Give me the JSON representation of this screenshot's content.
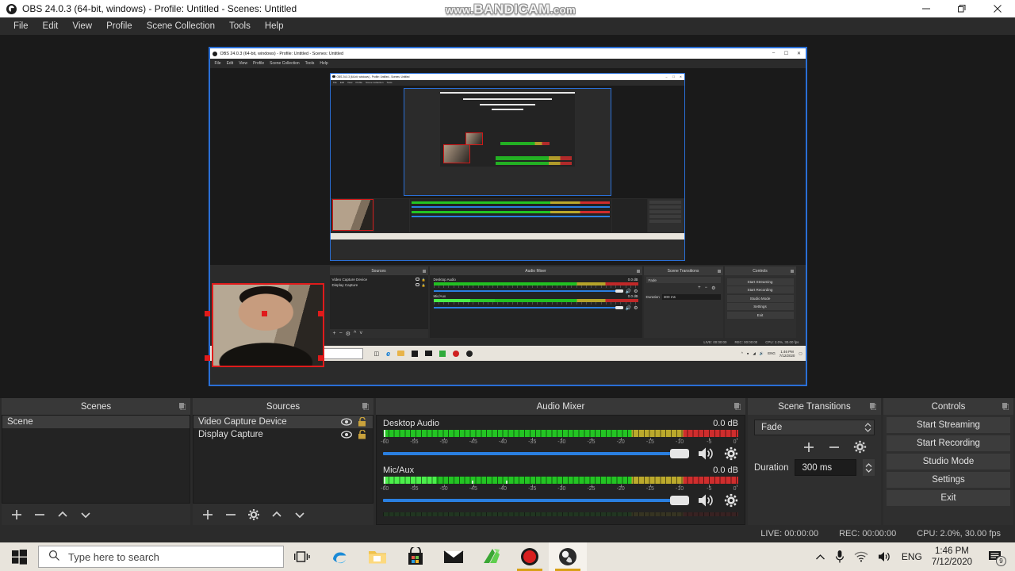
{
  "window": {
    "title": "OBS 24.0.3 (64-bit, windows) - Profile: Untitled - Scenes: Untitled",
    "logo_icon": "obs-logo-icon",
    "minimize_icon": "minimize-icon",
    "restore_icon": "restore-icon",
    "close_icon": "close-icon"
  },
  "watermark": {
    "prefix": "www.",
    "brand": "BANDICAM",
    "suffix": ".com"
  },
  "menubar": {
    "items": [
      "File",
      "Edit",
      "View",
      "Profile",
      "Scene Collection",
      "Tools",
      "Help"
    ]
  },
  "preview": {
    "selected_source_border_color": "#e01b1b",
    "capture_border_color": "#2a6fd6",
    "nested_title": "OBS 24.0.3 (64-bit, windows) - Profile: Untitled - Scenes: Untitled",
    "nested_title_2": "OBS 24.0.3 (64-bit, windows) - Profile: Untitled - Scenes: Untitled"
  },
  "scenes": {
    "header": "Scenes",
    "pin_icon": "pin-icon",
    "items": [
      {
        "label": "Scene",
        "selected": true
      }
    ],
    "footer_icons": [
      "add-icon",
      "remove-icon",
      "move-up-icon",
      "move-down-icon"
    ]
  },
  "sources": {
    "header": "Sources",
    "pin_icon": "pin-icon",
    "items": [
      {
        "label": "Video Capture Device",
        "visible": true,
        "locked": false
      },
      {
        "label": "Display Capture",
        "visible": true,
        "locked": false
      }
    ],
    "footer_icons": [
      "add-icon",
      "remove-icon",
      "properties-gear-icon",
      "move-up-icon",
      "move-down-icon"
    ]
  },
  "audio_mixer": {
    "header": "Audio Mixer",
    "pin_icon": "pin-icon",
    "scale_ticks": [
      -60,
      -55,
      -50,
      -45,
      -40,
      -35,
      -30,
      -25,
      -20,
      -15,
      -10,
      -5,
      0
    ],
    "channels": [
      {
        "name": "Desktop Audio",
        "db": "0.0 dB",
        "level_pct": 100,
        "hot_pct": 0,
        "fader_pct": 100,
        "mute_icon": "speaker-icon",
        "settings_icon": "gear-icon"
      },
      {
        "name": "Mic/Aux",
        "db": "0.0 dB",
        "level_pct": 100,
        "hot_pct": 15,
        "fader_pct": 100,
        "mute_icon": "speaker-icon",
        "settings_icon": "gear-icon"
      }
    ]
  },
  "scene_transitions": {
    "header": "Scene Transitions",
    "pin_icon": "pin-icon",
    "transition": "Fade",
    "duration_label": "Duration",
    "duration_value": "300 ms",
    "icons": [
      "add-icon",
      "remove-icon",
      "gear-icon"
    ]
  },
  "controls": {
    "header": "Controls",
    "pin_icon": "pin-icon",
    "buttons": [
      "Start Streaming",
      "Start Recording",
      "Studio Mode",
      "Settings",
      "Exit"
    ]
  },
  "statusbar": {
    "live": "LIVE: 00:00:00",
    "rec": "REC: 00:00:00",
    "cpu": "CPU: 2.0%, 30.00 fps"
  },
  "taskbar": {
    "start_icon": "windows-start-icon",
    "search_icon": "search-icon",
    "search_placeholder": "Type here to search",
    "taskview_icon": "task-view-icon",
    "apps": [
      {
        "name": "edge-icon",
        "label": "Microsoft Edge",
        "running": false,
        "active": false
      },
      {
        "name": "file-explorer-icon",
        "label": "File Explorer",
        "running": false,
        "active": false
      },
      {
        "name": "microsoft-store-icon",
        "label": "Microsoft Store",
        "running": false,
        "active": false
      },
      {
        "name": "mail-icon",
        "label": "Mail",
        "running": false,
        "active": false
      },
      {
        "name": "bandicam-icon",
        "label": "Bandicam",
        "running": false,
        "active": false
      },
      {
        "name": "recorder-icon",
        "label": "Recorder",
        "running": true,
        "active": false
      },
      {
        "name": "obs-icon",
        "label": "OBS Studio",
        "running": true,
        "active": true
      }
    ],
    "tray": {
      "chevron_icon": "chevron-up-icon",
      "mic_icon": "microphone-icon",
      "network_icon": "wifi-icon",
      "volume_icon": "volume-icon",
      "language": "ENG",
      "time": "1:46 PM",
      "date": "7/12/2020",
      "notifications_icon": "notification-icon",
      "notifications_count": "9"
    }
  }
}
